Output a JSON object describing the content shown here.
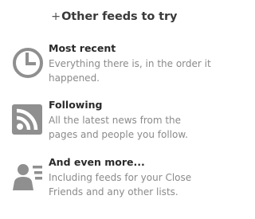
{
  "header": {
    "title": "Other feeds to try"
  },
  "feeds": [
    {
      "title": "Most recent",
      "description": "Everything there is, in the order it happened.",
      "icon": "clock-icon"
    },
    {
      "title": "Following",
      "description": "All the latest news from the pages and people you follow.",
      "icon": "rss-icon"
    },
    {
      "title": "And even more...",
      "description": "Including feeds for your Close Friends and any other lists.",
      "icon": "contact-list-icon"
    }
  ],
  "colors": {
    "icon": "#8f8f8f",
    "title": "#2a2a2a",
    "description": "#8a8a8a"
  }
}
